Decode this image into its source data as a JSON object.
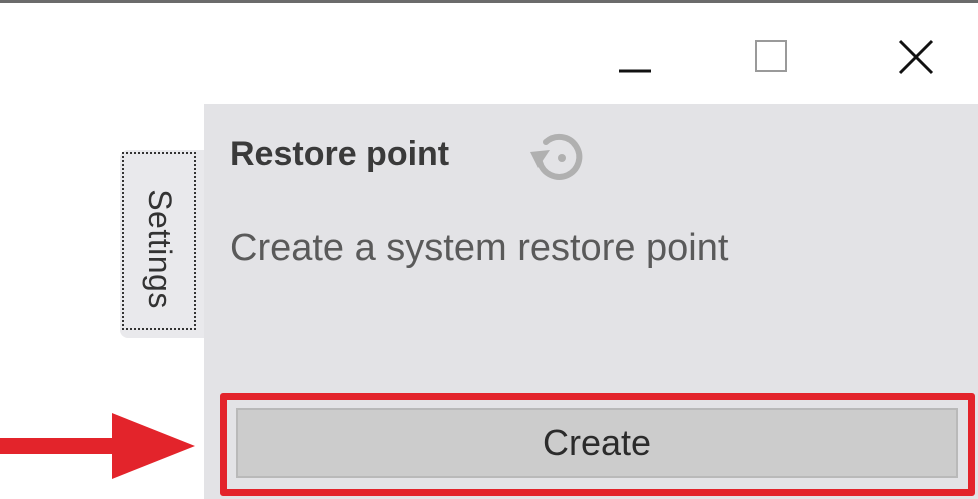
{
  "window": {
    "controls": [
      "minimize-icon",
      "maximize-icon",
      "close-icon"
    ]
  },
  "sidebar": {
    "tab_label": "Settings"
  },
  "restore_point": {
    "title": "Restore point",
    "title_icon": "restore-icon",
    "description": "Create a system restore point",
    "create_label": "Create"
  },
  "annotation": {
    "highlight_color": "#e3242b",
    "arrow_icon": "arrow-right-icon"
  },
  "colors": {
    "panel_bg": "#e3e3e6",
    "button_bg": "#cccccc"
  }
}
